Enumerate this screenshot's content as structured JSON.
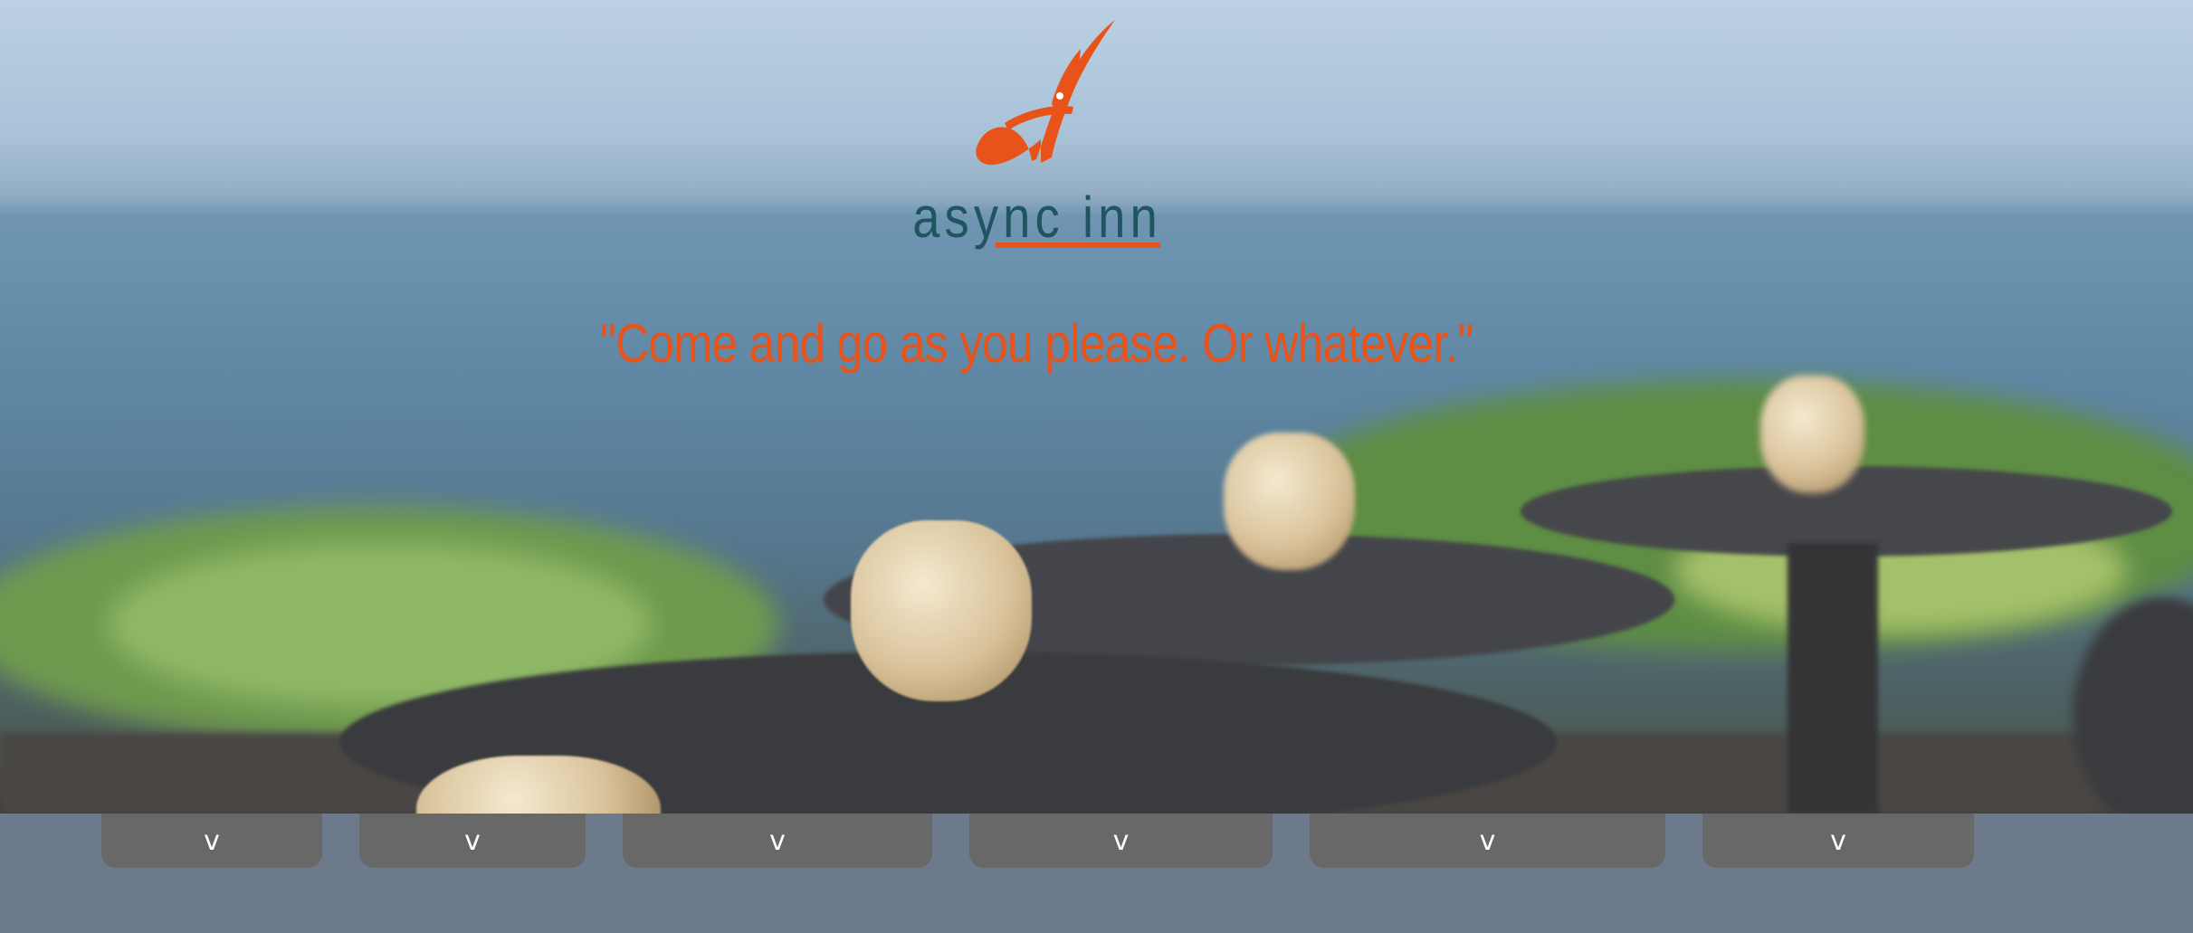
{
  "brand": {
    "logo_letter": "A",
    "name": "async inn"
  },
  "tagline": "\"Come and go as you please. Or whatever.\"",
  "colors": {
    "accent": "#e8531a",
    "brand_teal": "#1e5560",
    "nav_background": "#6c7a8b",
    "tab_background": "#686868"
  },
  "nav": {
    "tabs": [
      {
        "label": "v"
      },
      {
        "label": "v"
      },
      {
        "label": "v"
      },
      {
        "label": "v"
      },
      {
        "label": "v"
      },
      {
        "label": "v"
      }
    ]
  }
}
